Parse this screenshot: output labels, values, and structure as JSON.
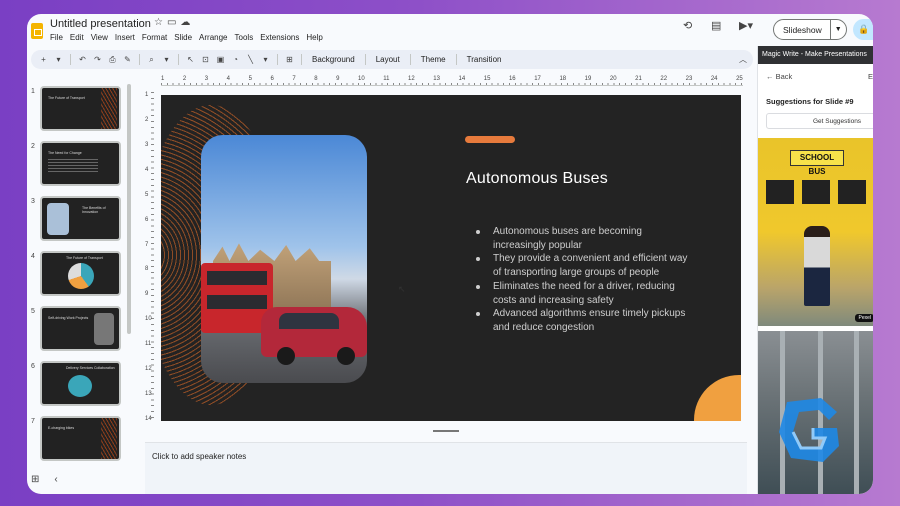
{
  "app": {
    "title": "Untitled presentation",
    "menu": [
      "File",
      "Edit",
      "View",
      "Insert",
      "Format",
      "Slide",
      "Arrange",
      "Tools",
      "Extensions",
      "Help"
    ],
    "slideshow_label": "Slideshow"
  },
  "toolbar": {
    "background_label": "Background",
    "layout_label": "Layout",
    "theme_label": "Theme",
    "transition_label": "Transition"
  },
  "filmstrip": {
    "slides": [
      {
        "num": "1",
        "title": "The Future of Transport"
      },
      {
        "num": "2",
        "title": "The Need for Change"
      },
      {
        "num": "3",
        "title": "The Benefits of Innovation"
      },
      {
        "num": "4",
        "title": "The Future of Transport"
      },
      {
        "num": "5",
        "title": "Self-driving Work Projects"
      },
      {
        "num": "6",
        "title": "Delivery Services Collaboration"
      },
      {
        "num": "7",
        "title": "E-charging bikes"
      }
    ]
  },
  "ruler": {
    "top": [
      "1",
      "2",
      "3",
      "4",
      "5",
      "6",
      "7",
      "8",
      "9",
      "10",
      "11",
      "12",
      "13",
      "14",
      "15",
      "16",
      "17",
      "18",
      "19",
      "20",
      "21",
      "22",
      "23",
      "24",
      "25"
    ],
    "left": [
      "1",
      "2",
      "3",
      "4",
      "5",
      "6",
      "7",
      "8",
      "9",
      "10",
      "11",
      "12",
      "13",
      "14"
    ]
  },
  "slide": {
    "heading": "Autonomous Buses",
    "bullets": [
      "Autonomous buses are becoming increasingly popular",
      "They provide a convenient and efficient way of transporting large groups of people",
      "Eliminates the need for a driver, reducing costs and increasing safety",
      "Advanced algorithms ensure timely pickups and reduce congestion"
    ],
    "accent_color": "#e67a3c"
  },
  "notes": {
    "placeholder": "Click to add speaker notes"
  },
  "sidebar": {
    "header": "Magic Write - Make Presentations",
    "back_label": "Back",
    "edge_label": "E",
    "suggestions_title": "Suggestions for Slide #9",
    "get_button": "Get Suggestions",
    "image1_sign": "SCHOOL BUS",
    "image1_tag": "Pexel"
  }
}
